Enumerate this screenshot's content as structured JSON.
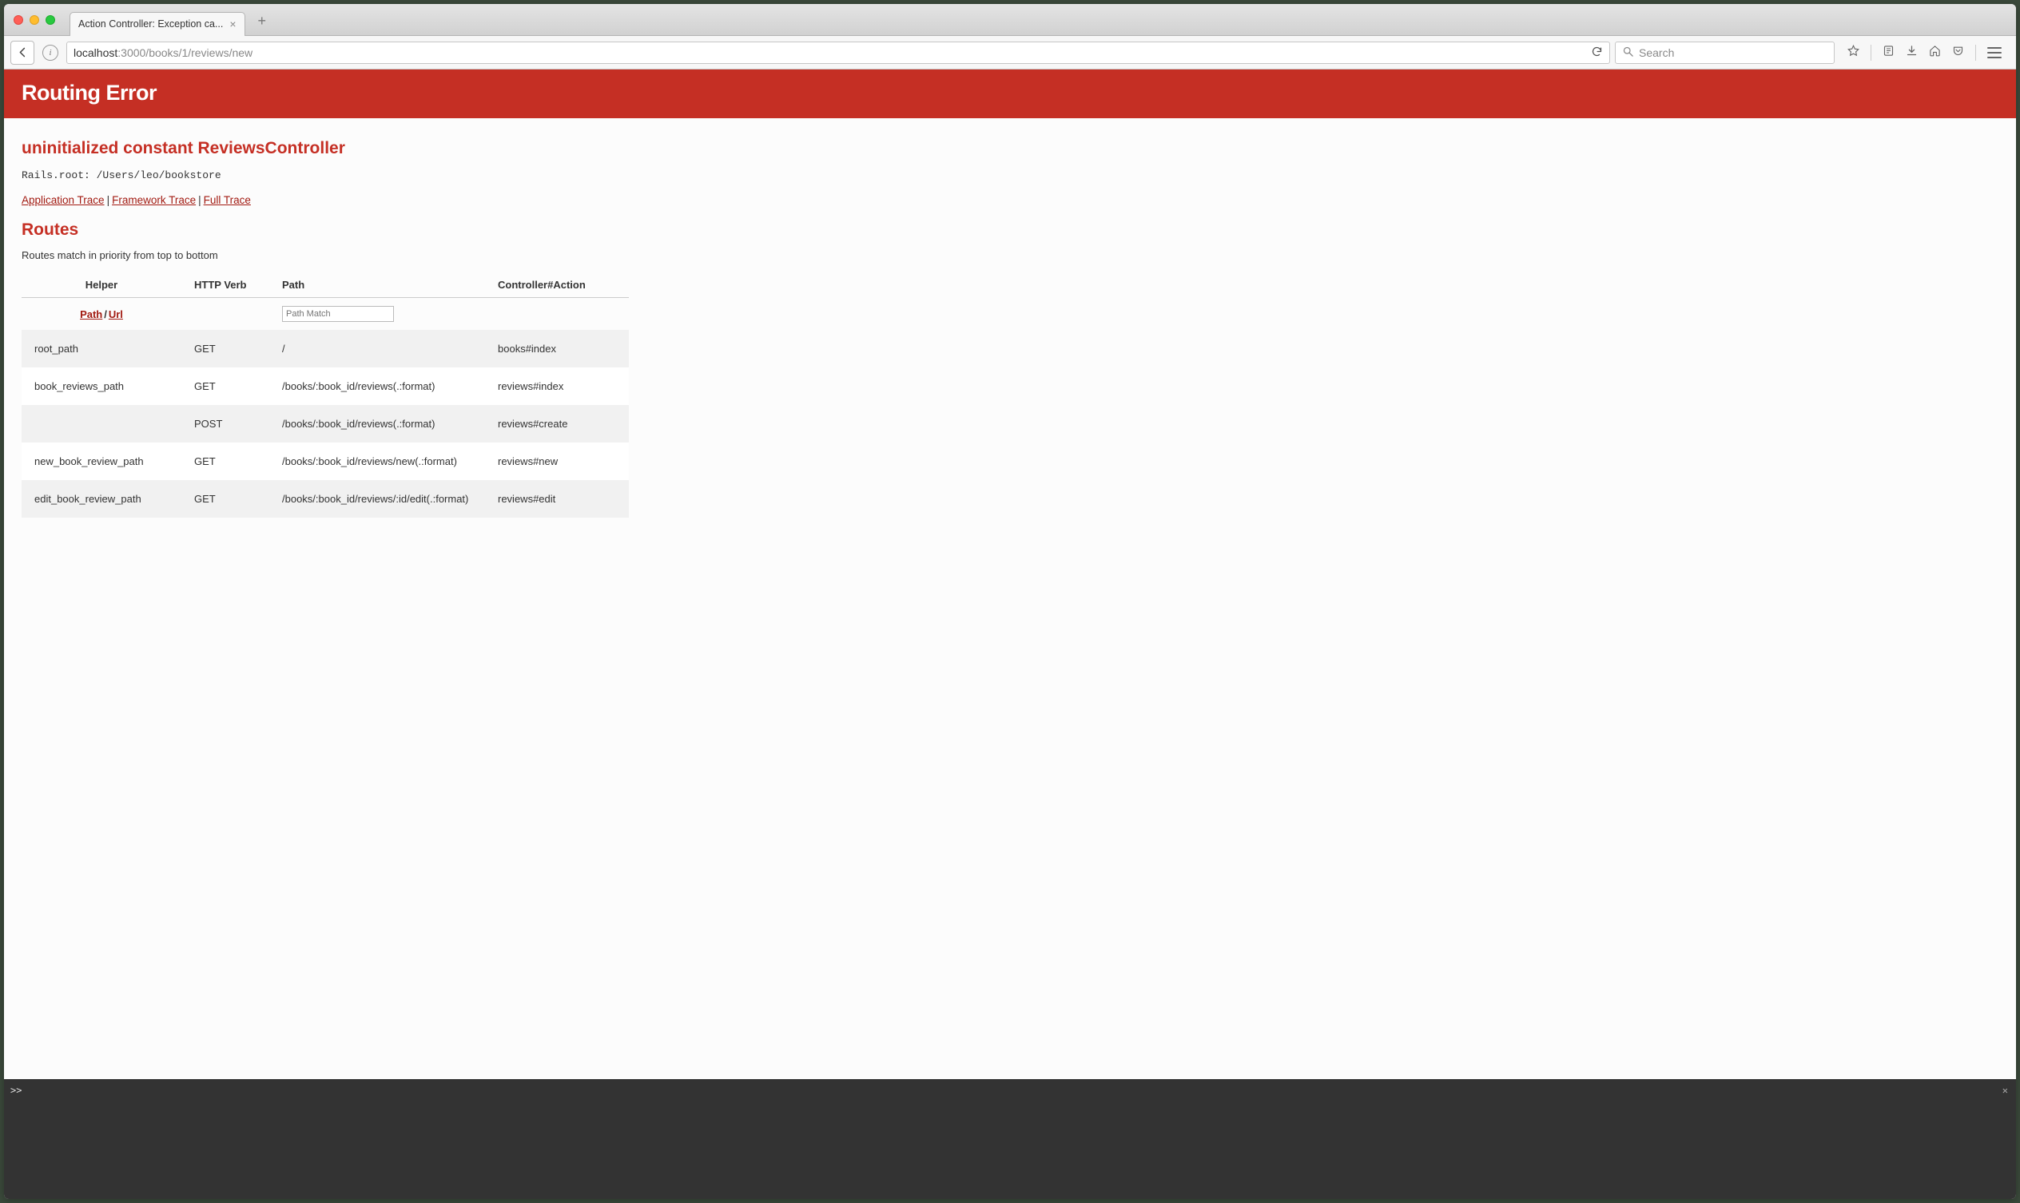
{
  "browser": {
    "tab_title": "Action Controller: Exception ca...",
    "url_host": "localhost",
    "url_rest": ":3000/books/1/reviews/new",
    "search_placeholder": "Search"
  },
  "error": {
    "title": "Routing Error",
    "message": "uninitialized constant ReviewsController",
    "rails_root": "Rails.root: /Users/leo/bookstore",
    "traces": {
      "app": "Application Trace",
      "framework": "Framework Trace",
      "full": "Full Trace"
    }
  },
  "routes": {
    "heading": "Routes",
    "description": "Routes match in priority from top to bottom",
    "columns": {
      "helper": "Helper",
      "verb": "HTTP Verb",
      "path": "Path",
      "action": "Controller#Action"
    },
    "helper_toggle": {
      "path": "Path",
      "url": "Url"
    },
    "path_filter_placeholder": "Path Match",
    "rows": [
      {
        "helper": "root_path",
        "verb": "GET",
        "path": "/",
        "action": "books#index"
      },
      {
        "helper": "book_reviews_path",
        "verb": "GET",
        "path": "/books/:book_id/reviews(.:format)",
        "action": "reviews#index"
      },
      {
        "helper": "",
        "verb": "POST",
        "path": "/books/:book_id/reviews(.:format)",
        "action": "reviews#create"
      },
      {
        "helper": "new_book_review_path",
        "verb": "GET",
        "path": "/books/:book_id/reviews/new(.:format)",
        "action": "reviews#new"
      },
      {
        "helper": "edit_book_review_path",
        "verb": "GET",
        "path": "/books/:book_id/reviews/:id/edit(.:format)",
        "action": "reviews#edit"
      }
    ]
  },
  "console": {
    "prompt": ">>"
  }
}
